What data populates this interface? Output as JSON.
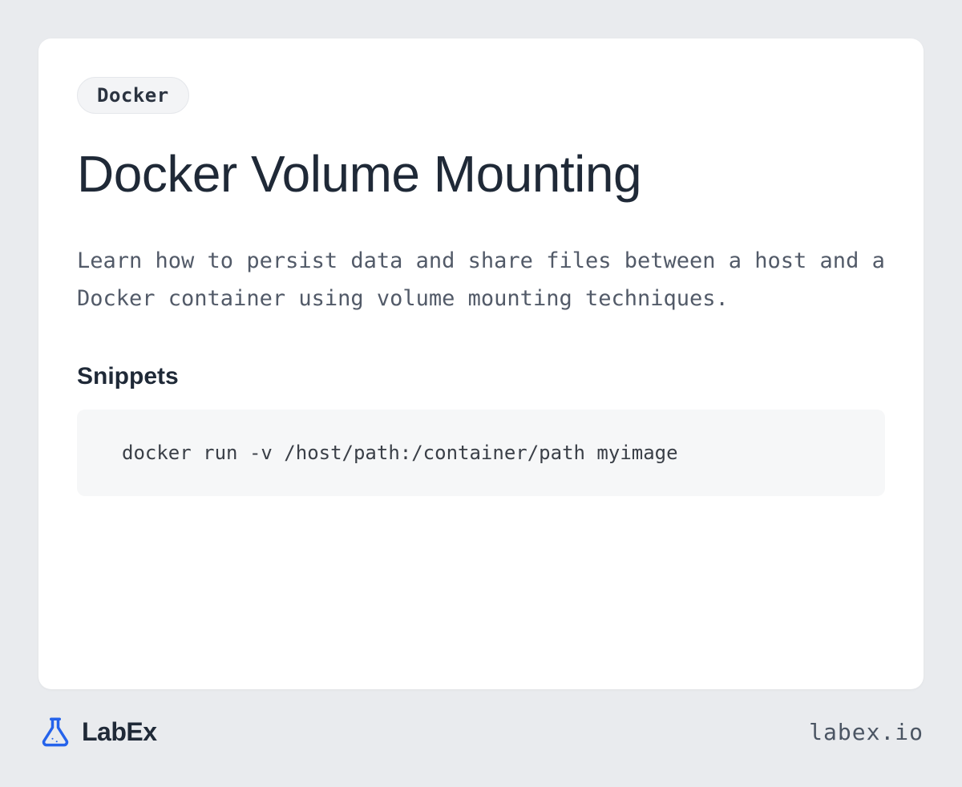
{
  "card": {
    "tag": "Docker",
    "title": "Docker Volume Mounting",
    "description": "Learn how to persist data and share files between a host and a Docker container using volume mounting techniques.",
    "snippets_heading": "Snippets",
    "snippets": [
      "docker run -v /host/path:/container/path myimage"
    ]
  },
  "footer": {
    "brand_name": "LabEx",
    "domain": "labex.io"
  },
  "colors": {
    "accent": "#2563eb",
    "page_bg": "#e9ebee",
    "card_bg": "#ffffff",
    "code_bg": "#f6f7f8"
  }
}
